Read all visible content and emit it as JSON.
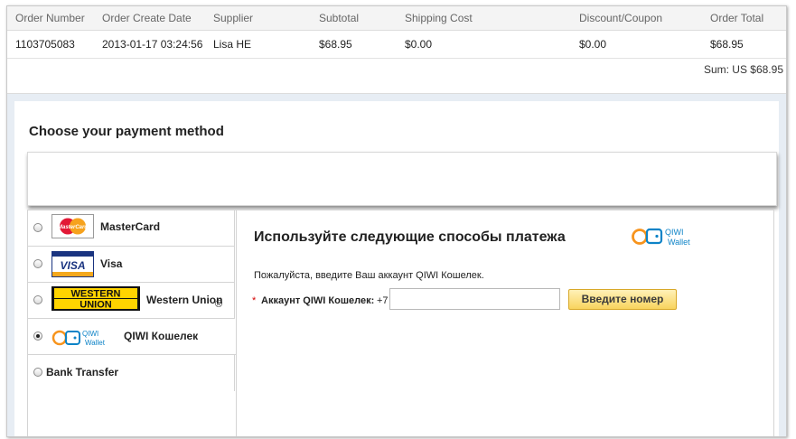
{
  "order_table": {
    "headers": [
      "Order Number",
      "Order Create Date",
      "Supplier",
      "Subtotal",
      "Shipping Cost",
      "Discount/Coupon",
      "Order Total"
    ],
    "row": [
      "1103705083",
      "2013-01-17 03:24:56",
      "Lisa HE",
      "$68.95",
      "$0.00",
      "$0.00",
      "$68.95"
    ],
    "sum": "Sum: US $68.95"
  },
  "payment": {
    "title": "Choose your payment method",
    "methods": [
      {
        "label": "MasterCard",
        "icon": "mastercard-logo",
        "selected": false
      },
      {
        "label": "Visa",
        "icon": "visa-logo",
        "selected": false
      },
      {
        "label": "Western Union",
        "icon": "western-union-logo",
        "selected": false
      },
      {
        "label": "QIWI Кошелек",
        "icon": "qiwi-wallet-logo",
        "selected": true
      },
      {
        "label": "Bank Transfer",
        "icon": "",
        "selected": false
      }
    ],
    "logos": {
      "mastercard": "MasterCard",
      "visa": "VISA",
      "wu_line1": "WESTERN",
      "wu_line2": "UNION",
      "registered": "®",
      "qiwi_top": "QIWI",
      "qiwi_bottom": "Wallet"
    },
    "qiwi_panel": {
      "heading": "Используйте следующие способы платежа",
      "description": "Пожалуйста, введите Ваш аккаунт QIWI Кошелек.",
      "required_mark": "*",
      "account_label": "Аккаунт QIWI Кошелек:",
      "phone_prefix": "+7",
      "account_value": "",
      "button_label": "Введите номер"
    }
  },
  "colors": {
    "accent_button": "#f8d45e",
    "section_background": "#e7edf4",
    "qiwi_orange": "#f7941d",
    "qiwi_blue": "#0d83c7"
  }
}
